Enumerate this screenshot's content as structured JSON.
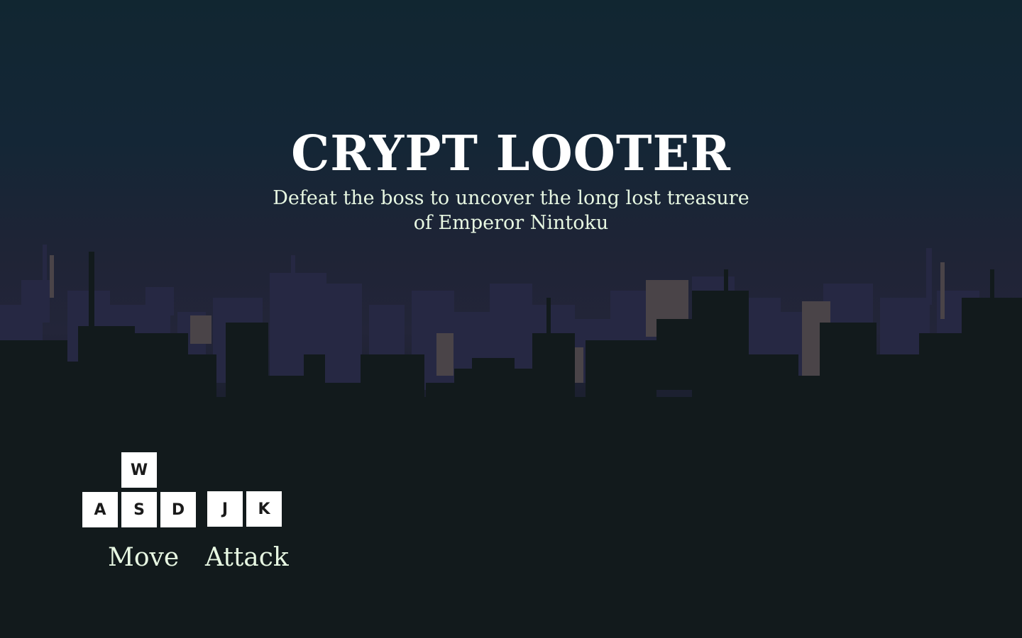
{
  "game": {
    "title": "CRYPT LOOTER",
    "subtitle": "Defeat the boss to uncover the long lost treasure of Emperor Nintoku"
  },
  "controls": {
    "move": {
      "keys": [
        "W",
        "A",
        "S",
        "D"
      ],
      "label": "Move"
    },
    "attack": {
      "keys": [
        "J",
        "K"
      ],
      "label": "Attack"
    }
  },
  "colors": {
    "sky_top": "#112631",
    "sky_mid": "#232539",
    "ground": "#121a1c",
    "skyline_far": "#262843",
    "skyline_accent": "#4a4448",
    "text_light": "#e7f7e2",
    "title": "#ffffff",
    "key_bg": "#ffffff"
  }
}
